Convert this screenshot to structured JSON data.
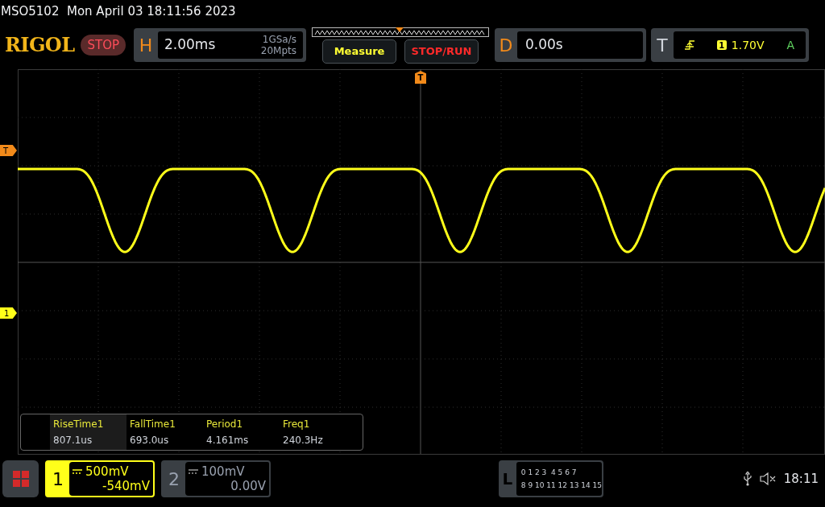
{
  "title_bar": {
    "text": "MSO5102  Mon April 03 18:11:56 2023"
  },
  "logo": "RIGOL",
  "run_state": {
    "label": "STOP",
    "kind": "stopped"
  },
  "horizontal": {
    "label": "H",
    "timebase": "2.00ms",
    "sample_rate": "1GSa/s",
    "memory_depth": "20Mpts"
  },
  "buttons": [
    {
      "label": "Measure",
      "kind": "measure"
    },
    {
      "label": "STOP/RUN",
      "kind": "stoprun"
    }
  ],
  "delay": {
    "label": "D",
    "value": "0.00s"
  },
  "trigger": {
    "label": "T",
    "source": "1",
    "level": "1.70V",
    "mode": "A"
  },
  "markers": {
    "trigger_top": "T",
    "trigger_level": "T",
    "channel": "1"
  },
  "measurements": [
    {
      "label": "RiseTime1",
      "value": "807.1us",
      "selected": true
    },
    {
      "label": "FallTime1",
      "value": "693.0us",
      "selected": false
    },
    {
      "label": "Period1",
      "value": "4.161ms",
      "selected": false
    },
    {
      "label": "Freq1",
      "value": "240.3Hz",
      "selected": false
    }
  ],
  "channels": [
    {
      "number": "1",
      "scale": "500mV",
      "offset": "-540mV",
      "active": true
    },
    {
      "number": "2",
      "scale": "100mV",
      "offset": "0.00V",
      "active": false
    }
  ],
  "logic": {
    "label": "L",
    "rows": [
      "0 1 2 3  4 5 6 7",
      "8 9 10 11 12 13 14 15"
    ]
  },
  "status": {
    "time": "18:11"
  }
}
